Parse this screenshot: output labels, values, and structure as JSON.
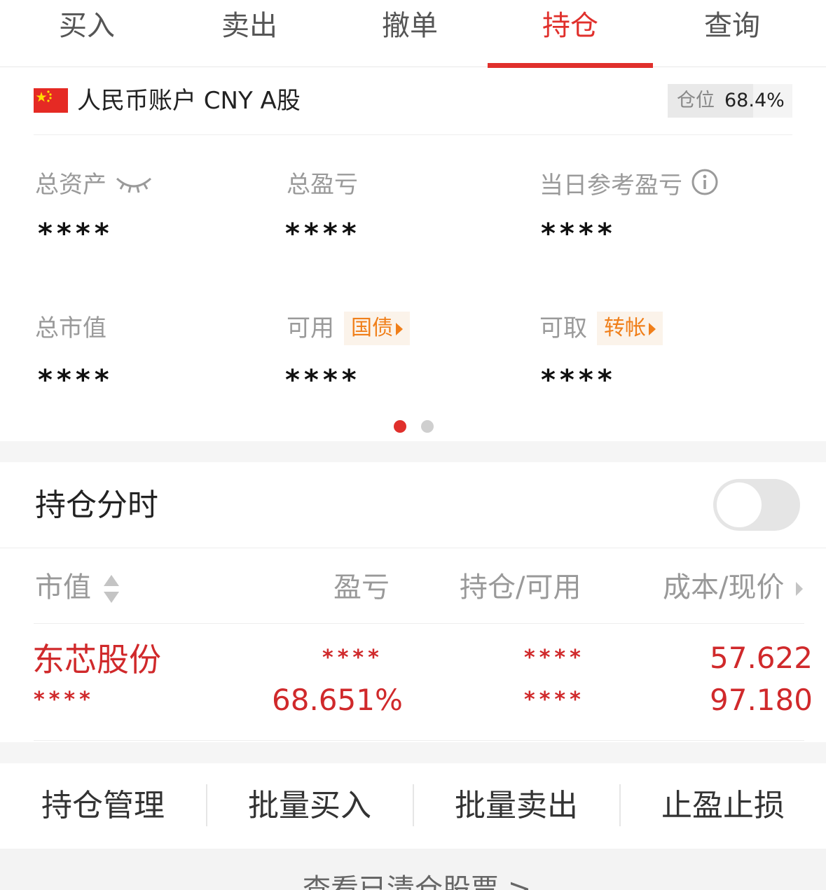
{
  "tabs": [
    {
      "label": "买入",
      "active": false
    },
    {
      "label": "卖出",
      "active": false
    },
    {
      "label": "撤单",
      "active": false
    },
    {
      "label": "持仓",
      "active": true
    },
    {
      "label": "查询",
      "active": false
    }
  ],
  "account": {
    "flag_icon": "china-flag-icon",
    "name": "人民币账户 CNY A股",
    "position_label": "仓位",
    "position_value": "68.4%",
    "position_fraction": 0.684
  },
  "metrics": {
    "total_assets": {
      "label": "总资产",
      "value": "****",
      "icon": "eye-closed-icon"
    },
    "total_pl": {
      "label": "总盈亏",
      "value": "****"
    },
    "daily_ref_pl": {
      "label": "当日参考盈亏",
      "value": "****",
      "icon": "info-icon"
    },
    "total_market_value": {
      "label": "总市值",
      "value": "****"
    },
    "available": {
      "label": "可用",
      "value": "****",
      "tag": "国债"
    },
    "withdrawable": {
      "label": "可取",
      "value": "****",
      "tag": "转帐"
    }
  },
  "pager": {
    "count": 2,
    "active_index": 0
  },
  "holding_timeshare": {
    "title": "持仓分时",
    "toggle_on": false
  },
  "table": {
    "headers": {
      "market_value": "市值",
      "pl": "盈亏",
      "holding_available": "持仓/可用",
      "cost_price": "成本/现价"
    },
    "rows": [
      {
        "name": "东芯股份",
        "market_value": "****",
        "pl_amount": "****",
        "pl_percent": "68.651%",
        "holding": "****",
        "available": "****",
        "cost": "57.622",
        "price": "97.180"
      }
    ]
  },
  "actions": [
    "持仓管理",
    "批量买入",
    "批量卖出",
    "止盈止损"
  ],
  "footer": {
    "text": "查看已清仓股票 >"
  },
  "colors": {
    "accent": "#e0302c",
    "orange": "#f07f1a",
    "label_gray": "#9a9a9a"
  }
}
